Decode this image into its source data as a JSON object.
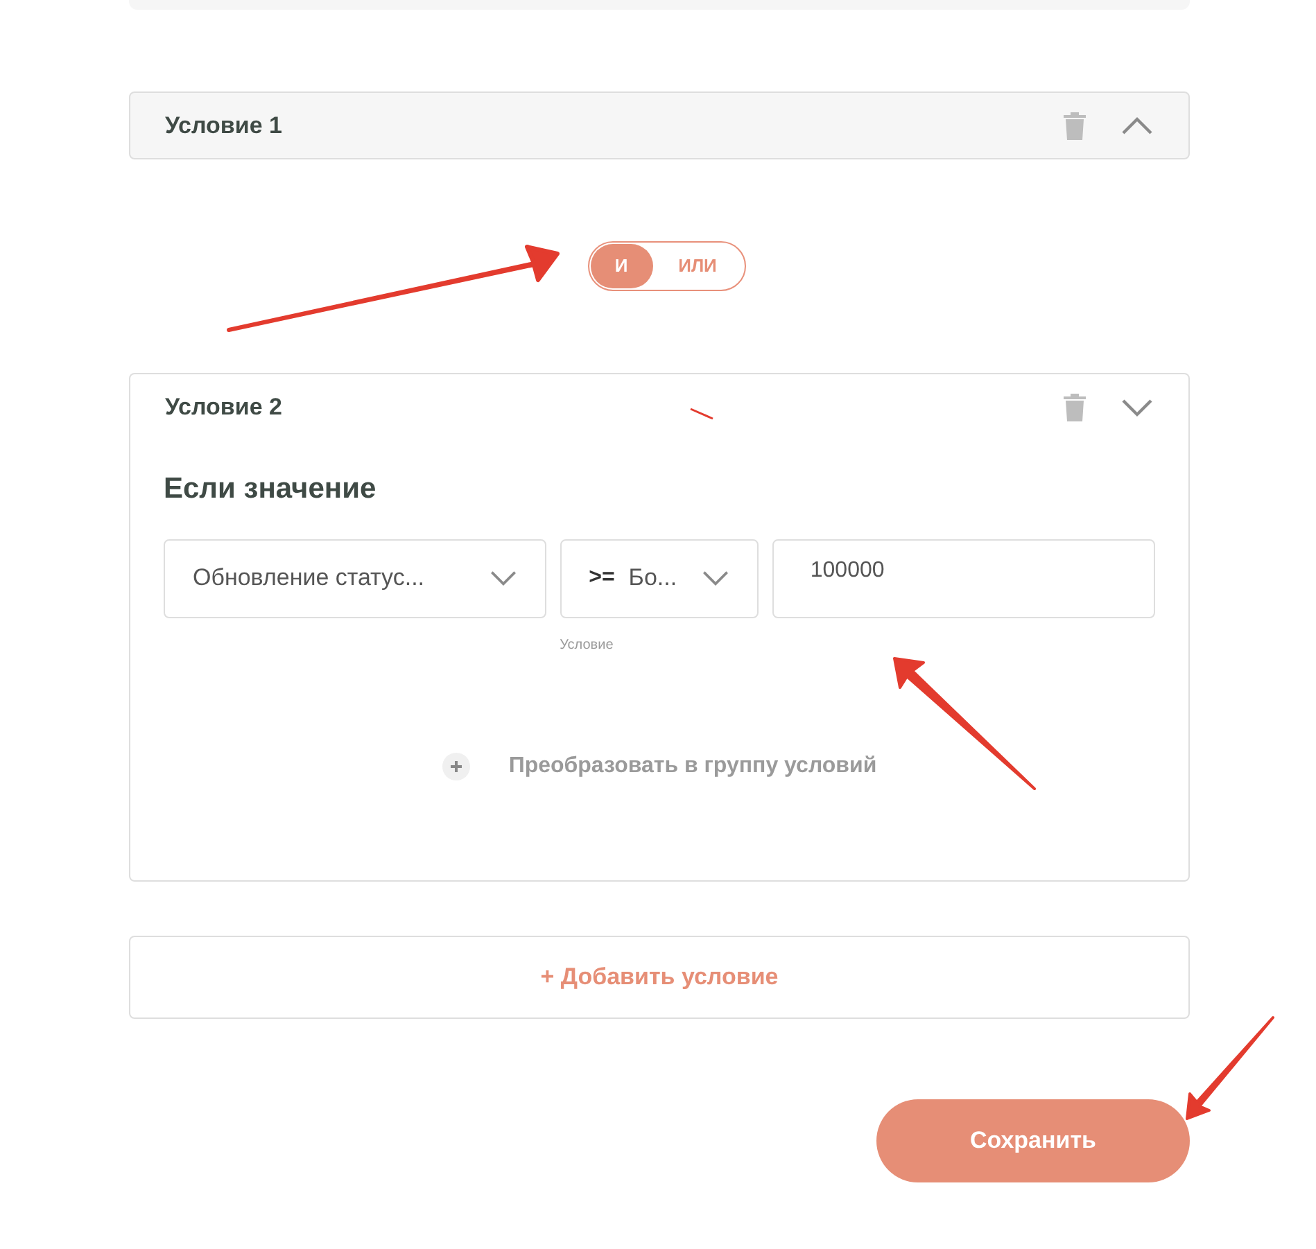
{
  "conditions": [
    {
      "title": "Условие 1",
      "expanded": false
    },
    {
      "title": "Условие 2",
      "expanded": true,
      "heading": "Если значение",
      "field": "Обновление статус...",
      "operator": {
        "symbol": ">=",
        "text": "Бо..."
      },
      "operator_caption": "Условие",
      "value": "100000",
      "convert_link": "Преобразовать в группу условий"
    }
  ],
  "logic_toggle": [
    {
      "label": "И",
      "selected": true
    },
    {
      "label": "ИЛИ",
      "selected": false
    }
  ],
  "add_condition": "+ Добавить условие",
  "save_button": "Сохранить"
}
